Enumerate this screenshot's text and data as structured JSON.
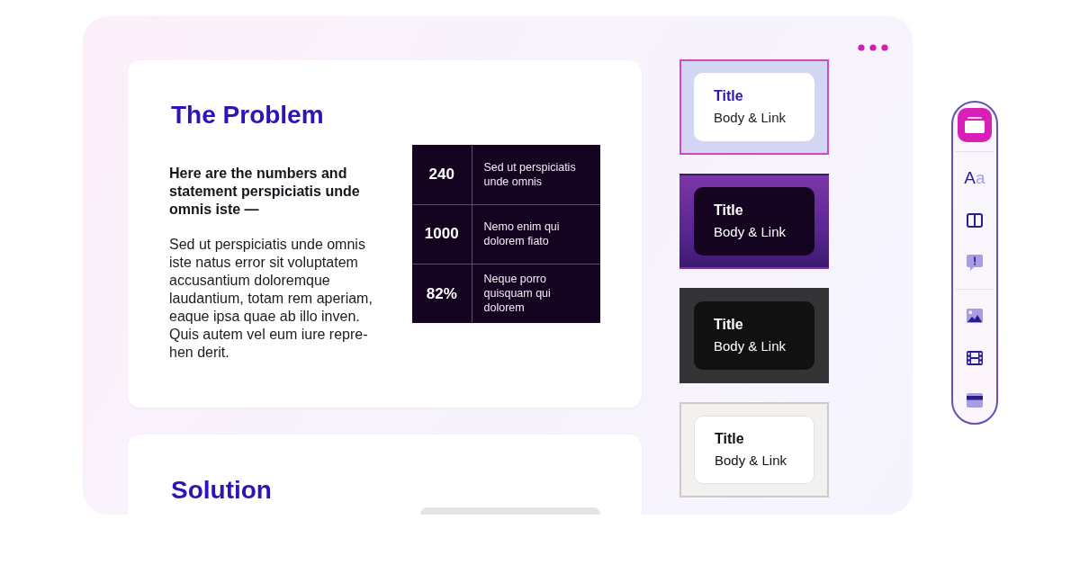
{
  "slides": [
    {
      "kind": "stats",
      "title": "The Problem",
      "lead": "Here are the numbers and\nstatement perspiciatis unde\nomnis iste —",
      "body": "Sed ut perspiciatis unde omnis\niste natus error sit voluptatem\naccusantium doloremque\nlaudantium, totam rem aperiam,\neaque ipsa quae ab illo inven.\nQuis autem vel eum iure repre-\nhen derit.",
      "stats": [
        {
          "value": "240",
          "text": "Sed ut perspiciatis\nunde omnis"
        },
        {
          "value": "1000",
          "text": "Nemo enim qui\ndolorem fiato"
        },
        {
          "value": "82%",
          "text": "Neque porro\nquisquam qui\ndolorem"
        }
      ]
    },
    {
      "kind": "media",
      "title": "Solution"
    }
  ],
  "themes": [
    {
      "kind": "light",
      "selected": true,
      "title": "Title",
      "body": "Body & Link"
    },
    {
      "kind": "purple",
      "selected": false,
      "title": "Title",
      "body": "Body & Link"
    },
    {
      "kind": "dark",
      "selected": false,
      "title": "Title",
      "body": "Body & Link"
    },
    {
      "kind": "neutral",
      "selected": false,
      "title": "Title",
      "body": "Body & Link"
    }
  ],
  "toolbar": {
    "groups": [
      {
        "items": [
          {
            "kind": "layout",
            "selected": true
          }
        ]
      },
      {
        "items": [
          {
            "kind": "text",
            "label": "Aa",
            "selected": false
          },
          {
            "kind": "columns",
            "selected": false
          },
          {
            "kind": "callout",
            "selected": false
          }
        ]
      },
      {
        "items": [
          {
            "kind": "image",
            "selected": false
          },
          {
            "kind": "video",
            "selected": false
          },
          {
            "kind": "banner",
            "selected": false
          }
        ]
      }
    ]
  }
}
